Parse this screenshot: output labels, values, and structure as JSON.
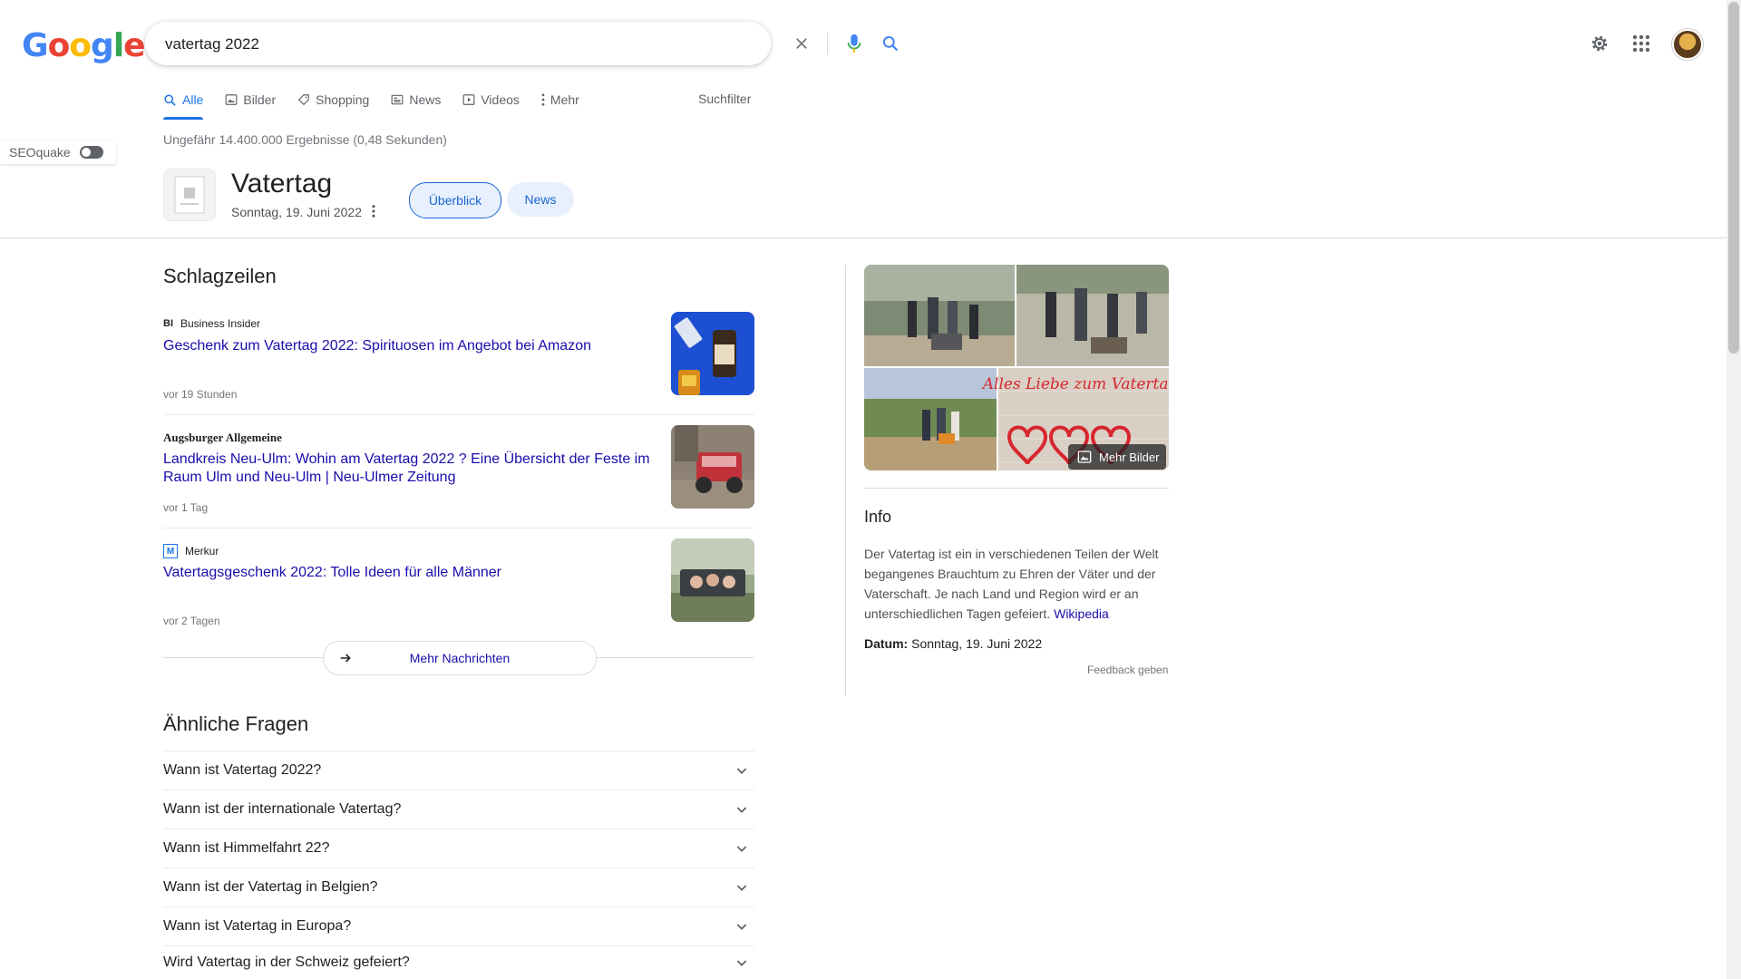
{
  "header": {
    "logo": "Google",
    "search_value": "vatertag 2022"
  },
  "tabs": [
    {
      "label": "Alle",
      "icon": "search-icon",
      "active": true
    },
    {
      "label": "Bilder",
      "icon": "image-icon"
    },
    {
      "label": "Shopping",
      "icon": "tag-icon"
    },
    {
      "label": "News",
      "icon": "newspaper-icon"
    },
    {
      "label": "Videos",
      "icon": "play-icon"
    },
    {
      "label": "Mehr",
      "icon": "more-vert-icon"
    }
  ],
  "suchfilter": "Suchfilter",
  "result_stats": "Ungefähr 14.400.000 Ergebnisse (0,48 Sekunden)",
  "seoquake": {
    "label": "SEOquake"
  },
  "entity": {
    "title": "Vatertag",
    "subtitle": "Sonntag, 19. Juni 2022",
    "chips": [
      "Überblick",
      "News"
    ]
  },
  "headlines": {
    "section_title": "Schlagzeilen",
    "items": [
      {
        "source_logo": "BI",
        "source": "Business Insider",
        "title": "Geschenk zum Vatertag 2022: Spirituosen im Angebot bei Amazon",
        "time": "vor 19 Stunden"
      },
      {
        "source_logo": "",
        "source": "Augsburger Allgemeine",
        "title": "Landkreis Neu-Ulm: Wohin am Vatertag 2022 ? Eine Übersicht der Feste im Raum Ulm und Neu-Ulm | Neu-Ulmer Zeitung",
        "time": "vor 1 Tag"
      },
      {
        "source_logo": "M",
        "source": "Merkur",
        "title": "Vatertagsgeschenk 2022: Tolle Ideen für alle Männer",
        "time": "vor 2 Tagen"
      }
    ],
    "more_button": "Mehr Nachrichten"
  },
  "paa": {
    "section_title": "Ähnliche Fragen",
    "questions": [
      "Wann ist Vatertag 2022?",
      "Wann ist der internationale Vatertag?",
      "Wann ist Himmelfahrt 22?",
      "Wann ist der Vatertag in Belgien?",
      "Wann ist Vatertag in Europa?",
      "Wird Vatertag in der Schweiz gefeiert?"
    ]
  },
  "knowledge_panel": {
    "image_text": "Alles Liebe zum Vatertag!",
    "more_images": "Mehr Bilder",
    "info_title": "Info",
    "description": "Der Vatertag ist ein in verschiedenen Teilen der Welt begangenes Brauchtum zu Ehren der Väter und der Vaterschaft. Je nach Land und Region wird er an unterschiedlichen Tagen gefeiert.",
    "wiki_link": "Wikipedia",
    "date_label": "Datum:",
    "date_value": "Sonntag, 19. Juni 2022",
    "feedback": "Feedback geben"
  },
  "colors": {
    "link": "#1a0dab",
    "accent": "#1a73e8",
    "google_blue": "#4285f4",
    "google_red": "#ea4335",
    "google_yellow": "#fbbc05",
    "google_green": "#34a853"
  }
}
